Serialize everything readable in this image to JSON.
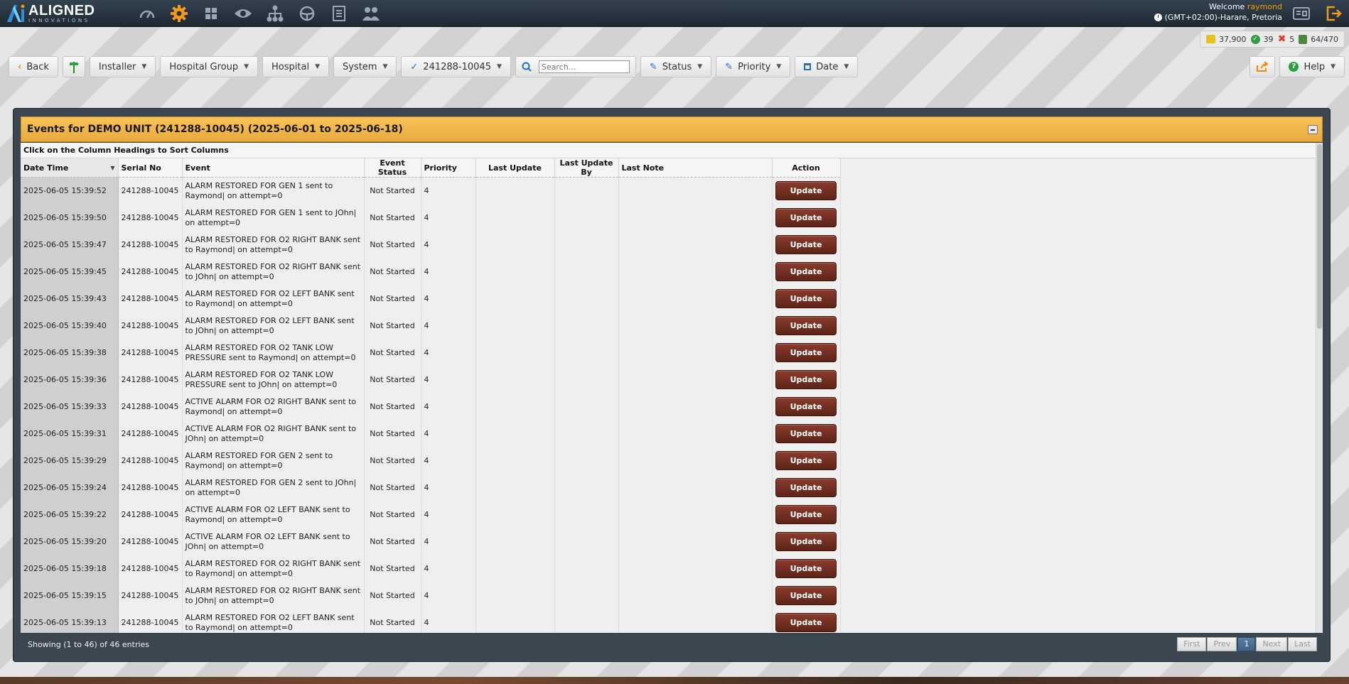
{
  "brand": {
    "name": "ALIGNED",
    "sub": "INNOVATIONS"
  },
  "nav_icons": [
    "dashboard-gauge-icon",
    "settings-gear-icon",
    "apps-grid-icon",
    "eye-icon",
    "hierarchy-icon",
    "steering-wheel-icon",
    "report-document-icon",
    "users-icon"
  ],
  "welcome": {
    "prefix": "Welcome",
    "user": "raymond",
    "timezone": "(GMT+02:00)-Harare, Pretoria"
  },
  "counters": [
    {
      "icon": "coins-icon",
      "value": "37,900"
    },
    {
      "icon": "check-circle-icon",
      "value": "39"
    },
    {
      "icon": "cross-icon",
      "value": "5"
    },
    {
      "icon": "devices-icon",
      "value": "64/470"
    }
  ],
  "toolbar": {
    "back": "Back",
    "installer": "Installer",
    "hospital_group": "Hospital Group",
    "hospital": "Hospital",
    "system": "System",
    "unit": "241288-10045",
    "search_placeholder": "Search...",
    "status": "Status",
    "priority": "Priority",
    "date": "Date",
    "help": "Help"
  },
  "panel": {
    "title": "Events for DEMO UNIT (241288-10045) (2025-06-01 to 2025-06-18)",
    "hint": "Click on the Column Headings to Sort Columns",
    "columns": [
      "Date Time",
      "Serial No",
      "Event",
      "Event Status",
      "Priority",
      "Last Update",
      "Last Update By",
      "Last Note",
      "Action"
    ],
    "update_label": "Update",
    "rows": [
      {
        "dt": "2025-06-05 15:39:52",
        "sn": "241288-10045",
        "ev": "ALARM RESTORED FOR GEN 1 sent to Raymond| on attempt=0",
        "st": "Not Started",
        "pr": "4"
      },
      {
        "dt": "2025-06-05 15:39:50",
        "sn": "241288-10045",
        "ev": "ALARM RESTORED FOR GEN 1 sent to JOhn| on attempt=0",
        "st": "Not Started",
        "pr": "4"
      },
      {
        "dt": "2025-06-05 15:39:47",
        "sn": "241288-10045",
        "ev": "ALARM RESTORED FOR O2 RIGHT BANK sent to Raymond| on attempt=0",
        "st": "Not Started",
        "pr": "4"
      },
      {
        "dt": "2025-06-05 15:39:45",
        "sn": "241288-10045",
        "ev": "ALARM RESTORED FOR O2 RIGHT BANK sent to JOhn| on attempt=0",
        "st": "Not Started",
        "pr": "4"
      },
      {
        "dt": "2025-06-05 15:39:43",
        "sn": "241288-10045",
        "ev": "ALARM RESTORED FOR O2 LEFT BANK sent to Raymond| on attempt=0",
        "st": "Not Started",
        "pr": "4"
      },
      {
        "dt": "2025-06-05 15:39:40",
        "sn": "241288-10045",
        "ev": "ALARM RESTORED FOR O2 LEFT BANK sent to JOhn| on attempt=0",
        "st": "Not Started",
        "pr": "4"
      },
      {
        "dt": "2025-06-05 15:39:38",
        "sn": "241288-10045",
        "ev": "ALARM RESTORED FOR O2 TANK LOW PRESSURE sent to Raymond| on attempt=0",
        "st": "Not Started",
        "pr": "4"
      },
      {
        "dt": "2025-06-05 15:39:36",
        "sn": "241288-10045",
        "ev": "ALARM RESTORED FOR O2 TANK LOW PRESSURE sent to JOhn| on attempt=0",
        "st": "Not Started",
        "pr": "4"
      },
      {
        "dt": "2025-06-05 15:39:33",
        "sn": "241288-10045",
        "ev": "ACTIVE ALARM FOR O2 RIGHT BANK sent to Raymond| on attempt=0",
        "st": "Not Started",
        "pr": "4"
      },
      {
        "dt": "2025-06-05 15:39:31",
        "sn": "241288-10045",
        "ev": "ACTIVE ALARM FOR O2 RIGHT BANK sent to JOhn| on attempt=0",
        "st": "Not Started",
        "pr": "4"
      },
      {
        "dt": "2025-06-05 15:39:29",
        "sn": "241288-10045",
        "ev": "ALARM RESTORED FOR GEN 2 sent to Raymond| on attempt=0",
        "st": "Not Started",
        "pr": "4"
      },
      {
        "dt": "2025-06-05 15:39:24",
        "sn": "241288-10045",
        "ev": "ALARM RESTORED FOR GEN 2 sent to JOhn| on attempt=0",
        "st": "Not Started",
        "pr": "4"
      },
      {
        "dt": "2025-06-05 15:39:22",
        "sn": "241288-10045",
        "ev": "ACTIVE ALARM FOR O2 LEFT BANK sent to Raymond| on attempt=0",
        "st": "Not Started",
        "pr": "4"
      },
      {
        "dt": "2025-06-05 15:39:20",
        "sn": "241288-10045",
        "ev": "ACTIVE ALARM FOR O2 LEFT BANK sent to JOhn| on attempt=0",
        "st": "Not Started",
        "pr": "4"
      },
      {
        "dt": "2025-06-05 15:39:18",
        "sn": "241288-10045",
        "ev": "ALARM RESTORED FOR O2 RIGHT BANK sent to Raymond| on attempt=0",
        "st": "Not Started",
        "pr": "4"
      },
      {
        "dt": "2025-06-05 15:39:15",
        "sn": "241288-10045",
        "ev": "ALARM RESTORED FOR O2 RIGHT BANK sent to JOhn| on attempt=0",
        "st": "Not Started",
        "pr": "4"
      },
      {
        "dt": "2025-06-05 15:39:13",
        "sn": "241288-10045",
        "ev": "ALARM RESTORED FOR O2 LEFT BANK sent to Raymond| on attempt=0",
        "st": "Not Started",
        "pr": "4"
      }
    ],
    "footer": "Showing (1 to 46) of 46 entries",
    "pager": [
      "First",
      "Prev",
      "1",
      "Next",
      "Last"
    ]
  },
  "colors": {
    "accent": "#f0a000",
    "header_bar": "#eaa93a",
    "update_button": "#6e2c1f",
    "topbar": "#27323e"
  }
}
